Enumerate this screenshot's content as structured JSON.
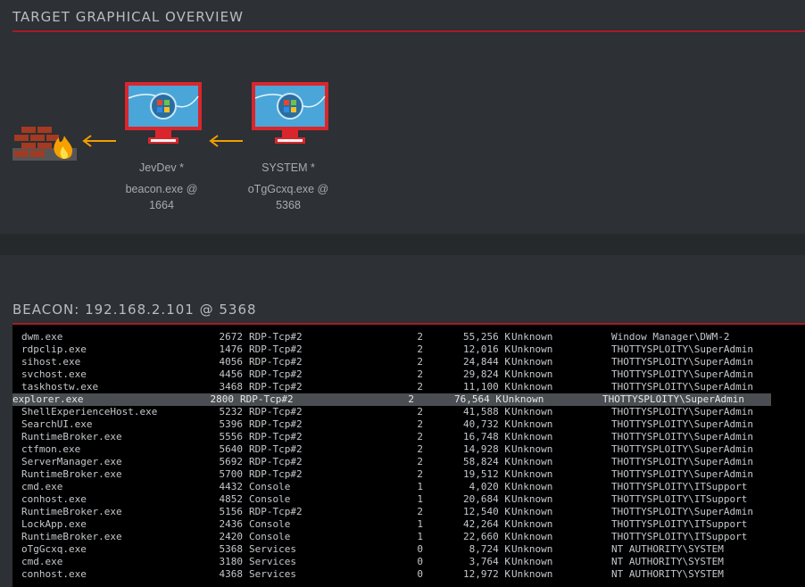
{
  "overview": {
    "title": "TARGET GRAPHICAL OVERVIEW"
  },
  "nodes": [
    {
      "name": "JevDev *",
      "process": "beacon.exe @",
      "pid": "1664"
    },
    {
      "name": "SYSTEM *",
      "process": "oTgGcxq.exe @",
      "pid": "5368"
    }
  ],
  "beacon": {
    "title": "BEACON: 192.168.2.101 @ 5368"
  },
  "colors": {
    "accent": "#a31b27",
    "arrow": "#f0a000",
    "monitor": "#d9262c"
  },
  "processes": [
    {
      "name": "dwm.exe",
      "pid": "2672",
      "session": "RDP-Tcp#2",
      "num": "2",
      "mem": "55,256 K",
      "status": "Unknown",
      "user": "Window Manager\\DWM-2"
    },
    {
      "name": "rdpclip.exe",
      "pid": "1476",
      "session": "RDP-Tcp#2",
      "num": "2",
      "mem": "12,016 K",
      "status": "Unknown",
      "user": "THOTTYSPLOITY\\SuperAdmin"
    },
    {
      "name": "sihost.exe",
      "pid": "4056",
      "session": "RDP-Tcp#2",
      "num": "2",
      "mem": "24,844 K",
      "status": "Unknown",
      "user": "THOTTYSPLOITY\\SuperAdmin"
    },
    {
      "name": "svchost.exe",
      "pid": "4456",
      "session": "RDP-Tcp#2",
      "num": "2",
      "mem": "29,824 K",
      "status": "Unknown",
      "user": "THOTTYSPLOITY\\SuperAdmin"
    },
    {
      "name": "taskhostw.exe",
      "pid": "3468",
      "session": "RDP-Tcp#2",
      "num": "2",
      "mem": "11,100 K",
      "status": "Unknown",
      "user": "THOTTYSPLOITY\\SuperAdmin"
    },
    {
      "name": "explorer.exe",
      "pid": "2800",
      "session": "RDP-Tcp#2",
      "num": "2",
      "mem": "76,564 K",
      "status": "Unknown",
      "user": "THOTTYSPLOITY\\SuperAdmin",
      "selected": true
    },
    {
      "name": "ShellExperienceHost.exe",
      "pid": "5232",
      "session": "RDP-Tcp#2",
      "num": "2",
      "mem": "41,588 K",
      "status": "Unknown",
      "user": "THOTTYSPLOITY\\SuperAdmin"
    },
    {
      "name": "SearchUI.exe",
      "pid": "5396",
      "session": "RDP-Tcp#2",
      "num": "2",
      "mem": "40,732 K",
      "status": "Unknown",
      "user": "THOTTYSPLOITY\\SuperAdmin"
    },
    {
      "name": "RuntimeBroker.exe",
      "pid": "5556",
      "session": "RDP-Tcp#2",
      "num": "2",
      "mem": "16,748 K",
      "status": "Unknown",
      "user": "THOTTYSPLOITY\\SuperAdmin"
    },
    {
      "name": "ctfmon.exe",
      "pid": "5640",
      "session": "RDP-Tcp#2",
      "num": "2",
      "mem": "14,928 K",
      "status": "Unknown",
      "user": "THOTTYSPLOITY\\SuperAdmin"
    },
    {
      "name": "ServerManager.exe",
      "pid": "5692",
      "session": "RDP-Tcp#2",
      "num": "2",
      "mem": "58,824 K",
      "status": "Unknown",
      "user": "THOTTYSPLOITY\\SuperAdmin"
    },
    {
      "name": "RuntimeBroker.exe",
      "pid": "5700",
      "session": "RDP-Tcp#2",
      "num": "2",
      "mem": "19,512 K",
      "status": "Unknown",
      "user": "THOTTYSPLOITY\\SuperAdmin"
    },
    {
      "name": "cmd.exe",
      "pid": "4432",
      "session": "Console",
      "num": "1",
      "mem": "4,020 K",
      "status": "Unknown",
      "user": "THOTTYSPLOITY\\ITSupport"
    },
    {
      "name": "conhost.exe",
      "pid": "4852",
      "session": "Console",
      "num": "1",
      "mem": "20,684 K",
      "status": "Unknown",
      "user": "THOTTYSPLOITY\\ITSupport"
    },
    {
      "name": "RuntimeBroker.exe",
      "pid": "5156",
      "session": "RDP-Tcp#2",
      "num": "2",
      "mem": "12,540 K",
      "status": "Unknown",
      "user": "THOTTYSPLOITY\\SuperAdmin"
    },
    {
      "name": "LockApp.exe",
      "pid": "2436",
      "session": "Console",
      "num": "1",
      "mem": "42,264 K",
      "status": "Unknown",
      "user": "THOTTYSPLOITY\\ITSupport"
    },
    {
      "name": "RuntimeBroker.exe",
      "pid": "2420",
      "session": "Console",
      "num": "1",
      "mem": "22,660 K",
      "status": "Unknown",
      "user": "THOTTYSPLOITY\\ITSupport"
    },
    {
      "name": "oTgGcxq.exe",
      "pid": "5368",
      "session": "Services",
      "num": "0",
      "mem": "8,724 K",
      "status": "Unknown",
      "user": "NT AUTHORITY\\SYSTEM"
    },
    {
      "name": "cmd.exe",
      "pid": "3180",
      "session": "Services",
      "num": "0",
      "mem": "3,764 K",
      "status": "Unknown",
      "user": "NT AUTHORITY\\SYSTEM"
    },
    {
      "name": "conhost.exe",
      "pid": "4368",
      "session": "Services",
      "num": "0",
      "mem": "12,972 K",
      "status": "Unknown",
      "user": "NT AUTHORITY\\SYSTEM"
    }
  ]
}
